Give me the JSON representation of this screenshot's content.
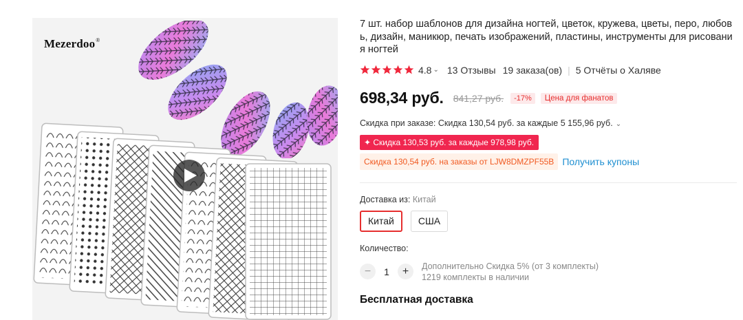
{
  "gallery": {
    "brand": "Mezerdoo",
    "brand_mark": "®",
    "play_icon": "play-icon"
  },
  "product": {
    "title": "7 шт. набор шаблонов для дизайна ногтей, цветок, кружева, цветы, перо, любовь, дизайн, маникюр, печать изображений, пластины, инструменты для рисования ногтей"
  },
  "rating": {
    "stars": 5,
    "value": "4.8",
    "reviews": "13 Отзывы",
    "orders": "19 заказа(ов)",
    "reports": "5 Отчёты о Халяве"
  },
  "price": {
    "current": "698,34 руб.",
    "old": "841,27 руб.",
    "discount_pct": "-17%",
    "fan_badge": "Цена для фанатов"
  },
  "discounts": {
    "order_discount": "Скидка при заказе: Скидка 130,54 руб. за каждые 5 155,96 руб.",
    "promo": "✦ Скидка 130,53 руб. за каждые 978,98 руб.",
    "coupon": "Скидка 130,54 руб. на заказы от LJW8DMZPF55B",
    "get_coupons": "Получить купоны"
  },
  "shipping": {
    "label": "Доставка из:",
    "selected": "Китай",
    "options": [
      "Китай",
      "США"
    ]
  },
  "quantity": {
    "label": "Количество:",
    "value": "1",
    "extra_discount": "Дополнительно Скидка 5% (от 3 комплекты)",
    "stock": "1219 комплекты в наличии"
  },
  "delivery": {
    "title": "Бесплатная доставка"
  },
  "colors": {
    "accent": "#e62e2e",
    "star": "#f0283c",
    "promo_bg": "#f0264f",
    "coupon_text": "#f05a22",
    "link": "#1f8fd1"
  }
}
